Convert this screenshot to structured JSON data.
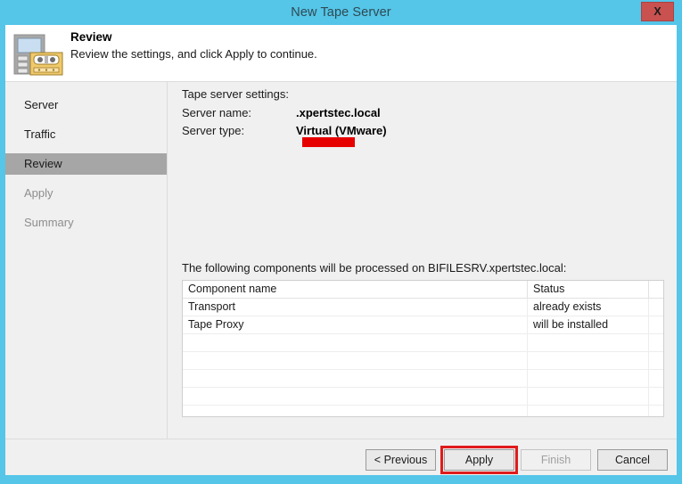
{
  "window": {
    "title": "New Tape Server",
    "close_label": "X",
    "close_icon": "close-icon",
    "titlebar_color": "#55c5e8",
    "close_button_color": "#c9514f"
  },
  "header": {
    "icon": "tape-library-icon",
    "title": "Review",
    "subtitle": "Review the settings, and click Apply to continue."
  },
  "sidebar": {
    "items": [
      {
        "label": "Server",
        "state": "normal"
      },
      {
        "label": "Traffic",
        "state": "normal"
      },
      {
        "label": "Review",
        "state": "selected"
      },
      {
        "label": "Apply",
        "state": "disabled"
      },
      {
        "label": "Summary",
        "state": "disabled"
      }
    ],
    "selected_color": "#a6a6a6"
  },
  "content": {
    "settings_heading": "Tape server settings:",
    "fields": [
      {
        "label": "Server name:",
        "value": ".xpertstec.local",
        "redacted": true,
        "redaction_color": "#e60000"
      },
      {
        "label": "Server type:",
        "value": "Virtual (VMware)",
        "redacted": false
      }
    ],
    "components_heading": "The following components will be processed on BIFILESRV.xpertstec.local:",
    "table": {
      "columns": [
        "Component name",
        "Status",
        ""
      ],
      "rows": [
        [
          "Transport",
          "already exists",
          ""
        ],
        [
          "Tape Proxy",
          "will be installed",
          ""
        ]
      ],
      "empty_row_count": 5
    }
  },
  "footer": {
    "buttons": [
      {
        "label": "< Previous",
        "state": "enabled",
        "highlighted": false
      },
      {
        "label": "Apply",
        "state": "enabled",
        "highlighted": true
      },
      {
        "label": "Finish",
        "state": "disabled",
        "highlighted": false
      },
      {
        "label": "Cancel",
        "state": "enabled",
        "highlighted": false
      }
    ],
    "highlight_color": "#e01b1b"
  }
}
